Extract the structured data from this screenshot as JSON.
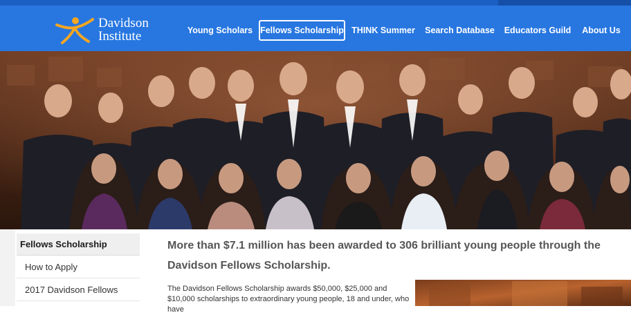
{
  "brand": {
    "line1": "Davidson",
    "line2": "Institute"
  },
  "nav": {
    "young_scholars": "Young Scholars",
    "fellows_scholarship": "Fellows Scholarship",
    "think_summer": "THINK Summer",
    "search_database": "Search Database",
    "educators_guild": "Educators Guild",
    "about_us": "About Us"
  },
  "sidebar": {
    "heading": "Fellows Scholarship",
    "items": [
      "How to Apply",
      "2017 Davidson Fellows"
    ]
  },
  "main": {
    "headline": "More than $7.1 million has been awarded to 306 brilliant young people through the Davidson Fellows Scholarship.",
    "intro": "The Davidson Fellows Scholarship awards $50,000, $25,000 and $10,000 scholarships to extraordinary young people, 18 and under, who have"
  },
  "colors": {
    "header": "#2877e1",
    "logo_accent": "#f5a623",
    "nav_text": "#ffffff"
  }
}
